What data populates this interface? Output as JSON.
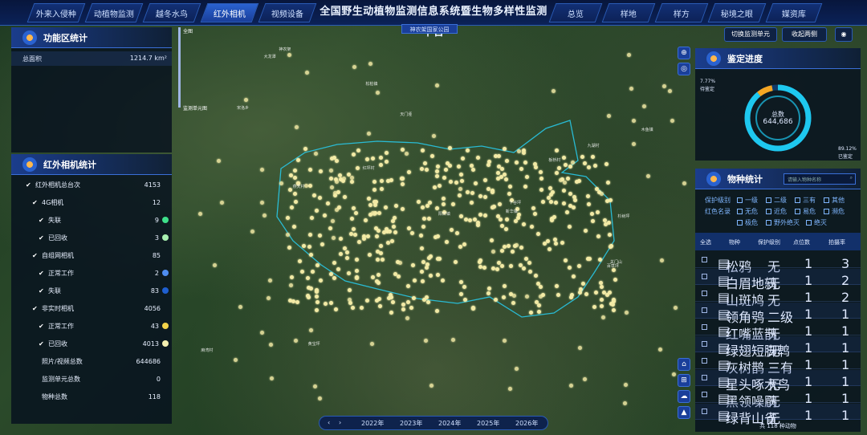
{
  "nav_left": [
    "外来入侵种",
    "动植物监测",
    "越冬水鸟",
    "红外相机",
    "视频设备"
  ],
  "nav_right": [
    "总览",
    "样地",
    "样方",
    "秘境之眼",
    "媒资库"
  ],
  "title": "全国野生动植物监测信息系统暨生物多样性监测平台",
  "subtab": "神农架国家公园",
  "func_panel": {
    "title": "功能区统计",
    "total_label": "总面积",
    "total_value": "1214.7 km²"
  },
  "camera_panel": {
    "title": "红外相机统计",
    "rows": [
      {
        "label": "红外相机总台次",
        "value": "4153",
        "check": true,
        "indent": 0,
        "dot": ""
      },
      {
        "label": "4G相机",
        "value": "12",
        "check": true,
        "indent": 1,
        "dot": ""
      },
      {
        "label": "失联",
        "value": "9",
        "check": true,
        "indent": 2,
        "dot": "#3ee08a"
      },
      {
        "label": "已回收",
        "value": "3",
        "check": true,
        "indent": 2,
        "dot": "#a8f0b0"
      },
      {
        "label": "自组网相机",
        "value": "85",
        "check": true,
        "indent": 1,
        "dot": ""
      },
      {
        "label": "正常工作",
        "value": "2",
        "check": true,
        "indent": 2,
        "dot": "#4f8df0"
      },
      {
        "label": "失联",
        "value": "83",
        "check": true,
        "indent": 2,
        "dot": "#1f5fd0"
      },
      {
        "label": "非实时相机",
        "value": "4056",
        "check": true,
        "indent": 1,
        "dot": ""
      },
      {
        "label": "正常工作",
        "value": "43",
        "check": true,
        "indent": 2,
        "dot": "#f2d34a"
      },
      {
        "label": "已回收",
        "value": "4013",
        "check": true,
        "indent": 2,
        "dot": "#f5efb0"
      },
      {
        "label": "照片/视频总数",
        "value": "644686",
        "check": false,
        "indent": 1,
        "dot": ""
      },
      {
        "label": "监测单元总数",
        "value": "0",
        "check": false,
        "indent": 1,
        "dot": ""
      },
      {
        "label": "物种总数",
        "value": "118",
        "check": false,
        "indent": 1,
        "dot": ""
      }
    ]
  },
  "legend_top": "全图",
  "legend_bottom": "监测单元图",
  "buttons": {
    "switch": "切换监测单元",
    "collapse": "收起两侧"
  },
  "ident_panel": {
    "title": "鉴定进度",
    "total_label": "总数",
    "total_value": "644,686",
    "left_pct": "7.77%",
    "left_label": "待鉴定",
    "right_pct": "89.12%",
    "right_label": "已鉴定",
    "done_fraction": 0.8912,
    "pending_fraction": 0.0777
  },
  "species_panel": {
    "title": "物种统计",
    "search_placeholder": "请输入物种名称",
    "filters_row1": {
      "label": "保护级别",
      "items": [
        "一级",
        "二级",
        "三有",
        "其他"
      ]
    },
    "filters_row2": {
      "label": "红色名录",
      "items": [
        "无危",
        "近危",
        "易危",
        "濒危"
      ]
    },
    "filters_row3": {
      "items": [
        "极危",
        "野外绝灭",
        "绝灭"
      ]
    },
    "headers": [
      "全选",
      "物种",
      "保护级别",
      "点位数",
      "拍摄率"
    ],
    "rows": [
      {
        "name": "松鸦",
        "level": "无",
        "points": "1",
        "rate": "3"
      },
      {
        "name": "白眉地鸫",
        "level": "无",
        "points": "1",
        "rate": "2"
      },
      {
        "name": "山斑鸠",
        "level": "无",
        "points": "1",
        "rate": "2"
      },
      {
        "name": "领角鸮",
        "level": "二级",
        "points": "1",
        "rate": "1"
      },
      {
        "name": "红嘴蓝鹊",
        "level": "无",
        "points": "1",
        "rate": "1"
      },
      {
        "name": "绿翅短脚鹎",
        "level": "无",
        "points": "1",
        "rate": "1"
      },
      {
        "name": "灰树鹊",
        "level": "三有",
        "points": "1",
        "rate": "1"
      },
      {
        "name": "星头啄木鸟",
        "level": "无",
        "points": "1",
        "rate": "1"
      },
      {
        "name": "黑领噪鹛",
        "level": "无",
        "points": "1",
        "rate": "1"
      },
      {
        "name": "绿背山雀",
        "level": "无",
        "points": "1",
        "rate": "1"
      }
    ],
    "footer": "共 118 种动物"
  },
  "years": [
    "2022年",
    "2023年",
    "2024年",
    "2025年",
    "2026年"
  ],
  "places": [
    "九湖村",
    "大龙潭",
    "神农架",
    "红坪村",
    "木鱼镇",
    "燕天村",
    "宋洛乡",
    "板桥村",
    "下谷坪",
    "松柏镇",
    "百草坪",
    "杉树坪",
    "阳日镇",
    "新华镇",
    "黄宝坪",
    "关门山",
    "天门垭",
    "麻湾村"
  ],
  "colors": {
    "accent": "#2a62d0",
    "dot": "#f2eaa5",
    "boundary": "#28c7e6"
  }
}
